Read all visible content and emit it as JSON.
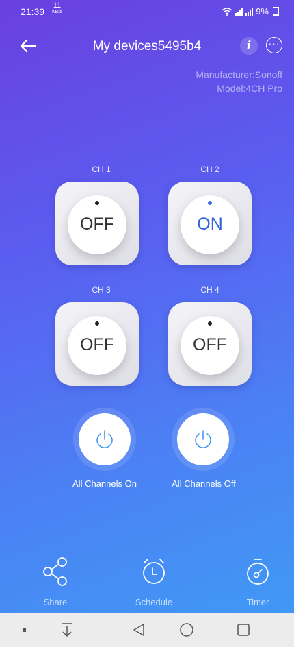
{
  "status_bar": {
    "time": "21:39",
    "speed_value": "11",
    "speed_unit": "KB/s",
    "battery": "9%"
  },
  "header": {
    "title": "My devices5495b4"
  },
  "device_info": {
    "manufacturer": "Manufacturer:Sonoff",
    "model": "Model:4CH Pro"
  },
  "channels": [
    {
      "label": "CH 1",
      "state": "OFF"
    },
    {
      "label": "CH 2",
      "state": "ON"
    },
    {
      "label": "CH 3",
      "state": "OFF"
    },
    {
      "label": "CH 4",
      "state": "OFF"
    }
  ],
  "actions": {
    "all_on": "All Channels On",
    "all_off": "All Channels Off"
  },
  "bottom_bar": {
    "share": "Share",
    "schedule": "Schedule",
    "timer": "Timer"
  },
  "colors": {
    "accent": "#2f64d8",
    "gradient_top": "#6a3fe0",
    "gradient_bottom": "#3f9cf5",
    "nav_bar": "#ececec"
  }
}
